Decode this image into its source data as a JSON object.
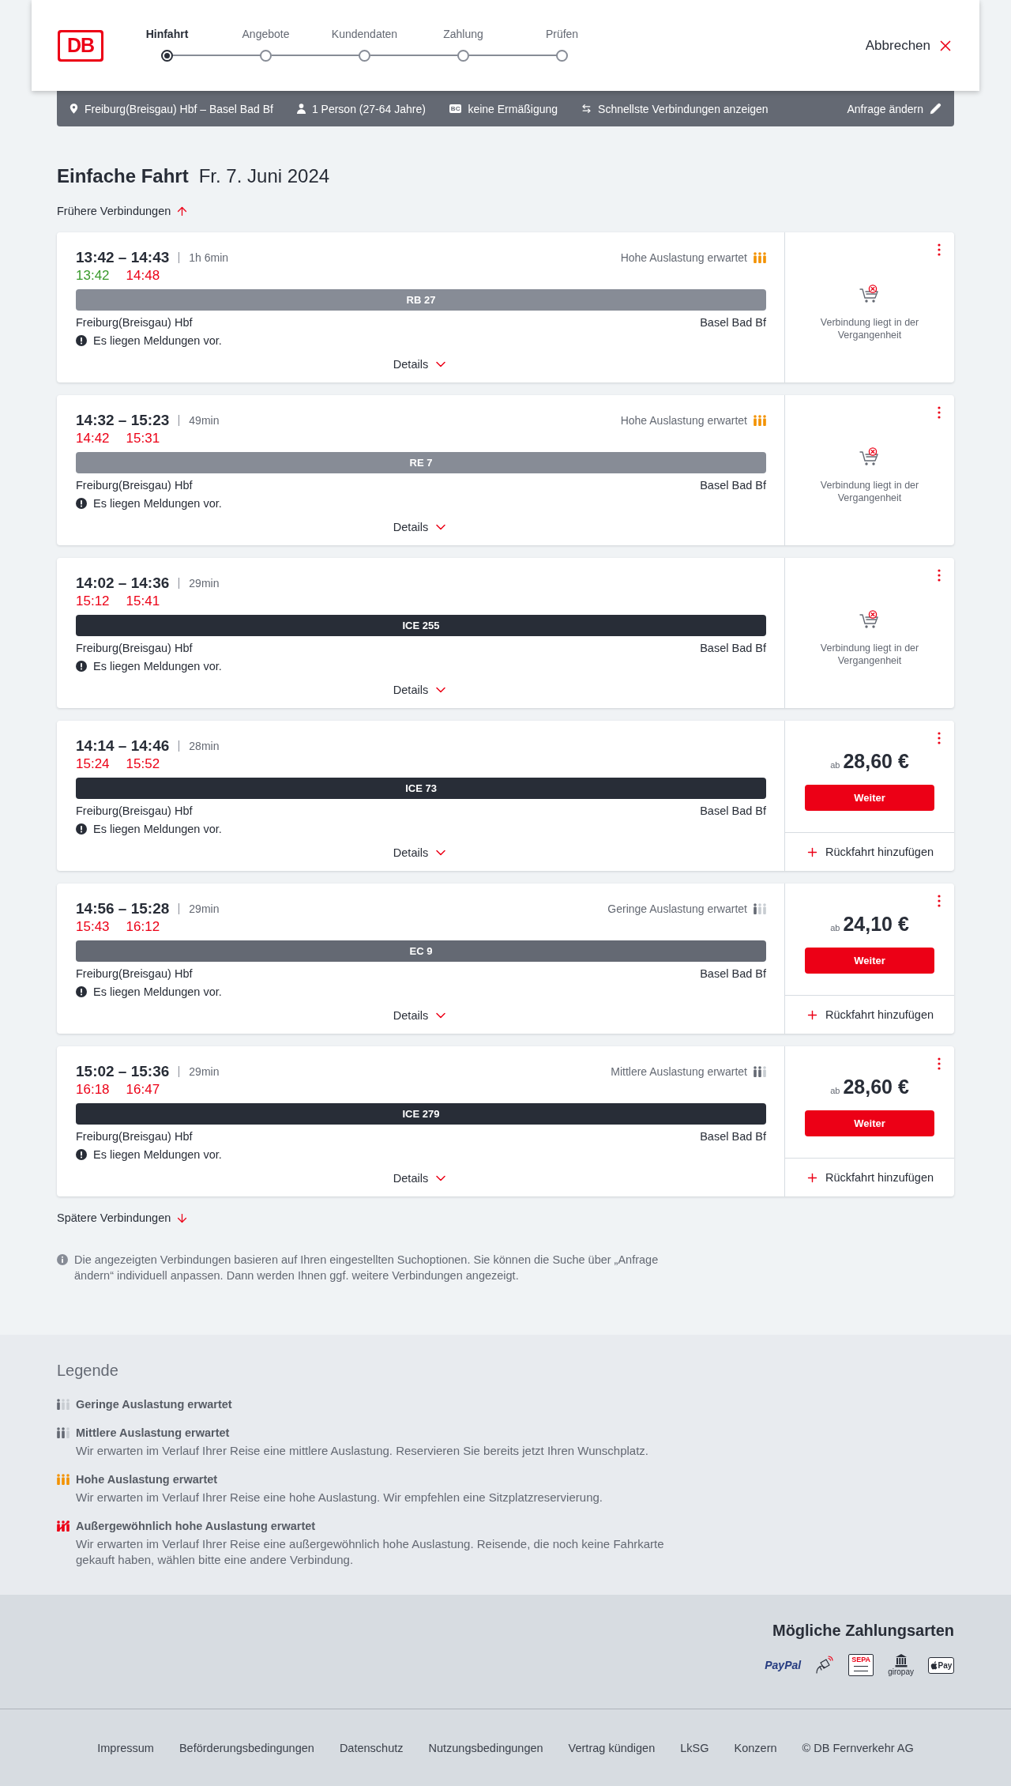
{
  "header": {
    "logo": "DB",
    "steps": [
      {
        "label": "Hinfahrt",
        "selected": true
      },
      {
        "label": "Angebote",
        "selected": false
      },
      {
        "label": "Kundendaten",
        "selected": false
      },
      {
        "label": "Zahlung",
        "selected": false
      },
      {
        "label": "Prüfen",
        "selected": false
      }
    ],
    "cancel": "Abbrechen"
  },
  "search_summary": {
    "items": [
      {
        "kind": "route",
        "label": "Freiburg(Breisgau) Hbf – Basel Bad Bf"
      },
      {
        "kind": "travellers",
        "label": "1 Person (27-64 Jahre)"
      },
      {
        "kind": "discount",
        "badge": "BC",
        "label": "keine Ermäßigung"
      },
      {
        "kind": "options",
        "label": "Schnellste Verbindungen anzeigen"
      }
    ],
    "edit": "Anfrage ändern"
  },
  "title": {
    "trip_type": "Einfache Fahrt",
    "date": "Fr. 7. Juni 2024"
  },
  "earlier_link": "Frühere Verbindungen",
  "connections": [
    {
      "times": "13:42 – 14:43",
      "duration": "1h 6min",
      "realtime": [
        {
          "time": "13:42",
          "delayed": false
        },
        {
          "time": "14:48",
          "delayed": true
        }
      ],
      "occupancy": {
        "kind": "high",
        "label": "Hohe Auslastung erwartet"
      },
      "train": {
        "label": "RB 27",
        "color": "#878c96"
      },
      "from": "Freiburg(Breisgau) Hbf",
      "to": "Basel Bad Bf",
      "notice": "Es liegen Meldungen vor.",
      "details": "Details",
      "offer": {
        "kind": "past",
        "text": "Verbindung liegt in der Vergangenheit"
      }
    },
    {
      "times": "14:32 – 15:23",
      "duration": "49min",
      "realtime": [
        {
          "time": "14:42",
          "delayed": true
        },
        {
          "time": "15:31",
          "delayed": true
        }
      ],
      "occupancy": {
        "kind": "high",
        "label": "Hohe Auslastung erwartet"
      },
      "train": {
        "label": "RE 7",
        "color": "#878c96"
      },
      "from": "Freiburg(Breisgau) Hbf",
      "to": "Basel Bad Bf",
      "notice": "Es liegen Meldungen vor.",
      "details": "Details",
      "offer": {
        "kind": "past",
        "text": "Verbindung liegt in der Vergangenheit"
      }
    },
    {
      "times": "14:02 – 14:36",
      "duration": "29min",
      "realtime": [
        {
          "time": "15:12",
          "delayed": true
        },
        {
          "time": "15:41",
          "delayed": true
        }
      ],
      "train": {
        "label": "ICE 255",
        "color": "#282d37"
      },
      "from": "Freiburg(Breisgau) Hbf",
      "to": "Basel Bad Bf",
      "notice": "Es liegen Meldungen vor.",
      "details": "Details",
      "offer": {
        "kind": "past",
        "text": "Verbindung liegt in der Vergangenheit"
      }
    },
    {
      "times": "14:14 – 14:46",
      "duration": "28min",
      "realtime": [
        {
          "time": "15:24",
          "delayed": true
        },
        {
          "time": "15:52",
          "delayed": true
        }
      ],
      "train": {
        "label": "ICE 73",
        "color": "#282d37"
      },
      "from": "Freiburg(Breisgau) Hbf",
      "to": "Basel Bad Bf",
      "notice": "Es liegen Meldungen vor.",
      "details": "Details",
      "offer": {
        "kind": "price",
        "prefix": "ab",
        "price": "28,60 €",
        "button": "Weiter",
        "return_link": "Rückfahrt hinzufügen"
      }
    },
    {
      "times": "14:56 – 15:28",
      "duration": "29min",
      "realtime": [
        {
          "time": "15:43",
          "delayed": true
        },
        {
          "time": "16:12",
          "delayed": true
        }
      ],
      "occupancy": {
        "kind": "low",
        "label": "Geringe Auslastung erwartet"
      },
      "train": {
        "label": "EC 9",
        "color": "#646973"
      },
      "from": "Freiburg(Breisgau) Hbf",
      "to": "Basel Bad Bf",
      "notice": "Es liegen Meldungen vor.",
      "details": "Details",
      "offer": {
        "kind": "price",
        "prefix": "ab",
        "price": "24,10 €",
        "button": "Weiter",
        "return_link": "Rückfahrt hinzufügen"
      }
    },
    {
      "times": "15:02 – 15:36",
      "duration": "29min",
      "realtime": [
        {
          "time": "16:18",
          "delayed": true
        },
        {
          "time": "16:47",
          "delayed": true
        }
      ],
      "occupancy": {
        "kind": "medium",
        "label": "Mittlere Auslastung erwartet"
      },
      "train": {
        "label": "ICE 279",
        "color": "#282d37"
      },
      "from": "Freiburg(Breisgau) Hbf",
      "to": "Basel Bad Bf",
      "notice": "Es liegen Meldungen vor.",
      "details": "Details",
      "offer": {
        "kind": "price",
        "prefix": "ab",
        "price": "28,60 €",
        "button": "Weiter",
        "return_link": "Rückfahrt hinzufügen"
      }
    }
  ],
  "later_link": "Spätere Verbindungen",
  "info_note": "Die angezeigten Verbindungen basieren auf Ihren eingestellten Suchoptionen. Sie können die Suche über „Anfrage ändern“ individuell anpassen. Dann werden Ihnen ggf. weitere Verbindungen angezeigt.",
  "legend": {
    "title": "Legende",
    "items": [
      {
        "kind": "low",
        "label": "Geringe Auslastung erwartet"
      },
      {
        "kind": "medium",
        "label": "Mittlere Auslastung erwartet",
        "description": "Wir erwarten im Verlauf Ihrer Reise eine mittlere Auslastung. Reservieren Sie bereits jetzt Ihren Wunschplatz."
      },
      {
        "kind": "high",
        "label": "Hohe Auslastung erwartet",
        "description": "Wir erwarten im Verlauf Ihrer Reise eine hohe Auslastung. Wir empfehlen eine Sitzplatzreservierung."
      },
      {
        "kind": "exceptional",
        "label": "Außergewöhnlich hohe Auslastung erwartet",
        "description": "Wir erwarten im Verlauf Ihrer Reise eine außergewöhnlich hohe Auslastung. Reisende, die noch keine Fahrkarte gekauft haben, wählen bitte eine andere Verbindung."
      }
    ]
  },
  "payment": {
    "title": "Mögliche Zahlungsarten",
    "methods": [
      {
        "kind": "paypal",
        "label": "PayPal"
      },
      {
        "kind": "contactless"
      },
      {
        "kind": "sepa",
        "label": "SEPA"
      },
      {
        "kind": "giropay",
        "label": "giropay"
      },
      {
        "kind": "applepay",
        "label": "Pay"
      }
    ]
  },
  "footer": {
    "links": [
      "Impressum",
      "Beförderungsbedingungen",
      "Datenschutz",
      "Nutzungsbedingungen",
      "Vertrag kündigen",
      "LkSG",
      "Konzern"
    ],
    "copyright": "© DB Fernverkehr AG"
  }
}
